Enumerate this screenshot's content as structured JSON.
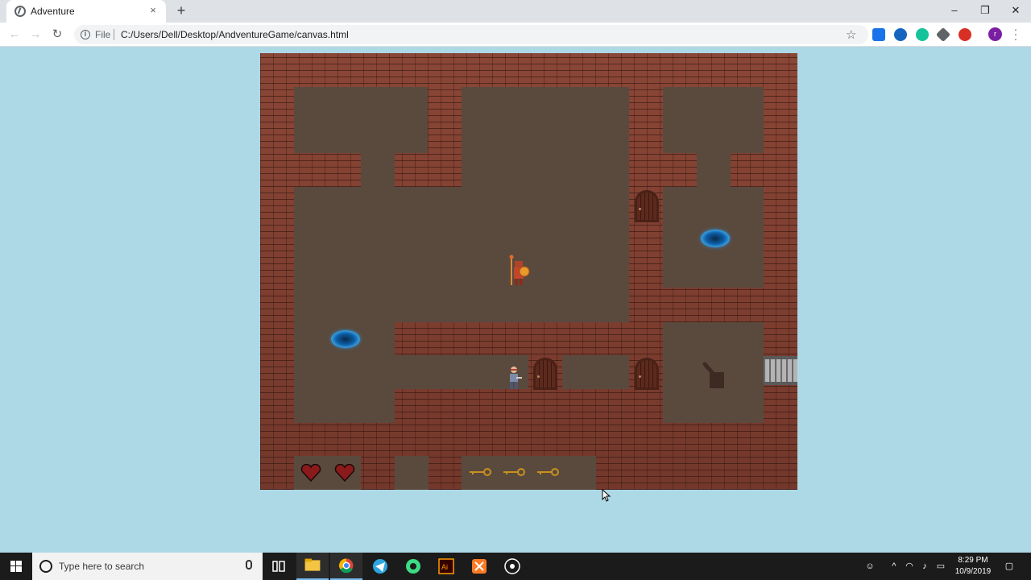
{
  "browser": {
    "tab_title": "Adventure",
    "tab_close": "×",
    "new_tab": "+",
    "address_scheme": "File",
    "address_url": "C:/Users/Dell/Desktop/AndventureGame/canvas.html",
    "profile_initial": "r",
    "window_controls": {
      "minimize": "–",
      "maximize": "❐",
      "close": "✕"
    },
    "extensions": [
      "screenshot-extension-icon",
      "a-extension-icon",
      "grammarly-icon",
      "puzzle-extension-icon",
      "adblock-icon"
    ]
  },
  "game": {
    "title": "Adventure",
    "hud": {
      "hearts": 2,
      "keys": 3
    },
    "colors": {
      "wall": "#7a3a2e",
      "floor": "#5a4a3e",
      "portal": "#0d5fa8",
      "heart": "#8b1a1a",
      "key": "#c8901e",
      "background": "#add8e6"
    }
  },
  "taskbar": {
    "search_placeholder": "Type here to search",
    "time": "8:29 PM",
    "date": "10/9/2019",
    "apps": [
      "task-view-icon",
      "file-explorer-icon",
      "chrome-icon",
      "telegram-icon",
      "android-studio-icon",
      "illustrator-icon",
      "xampp-icon",
      "obs-icon"
    ]
  }
}
